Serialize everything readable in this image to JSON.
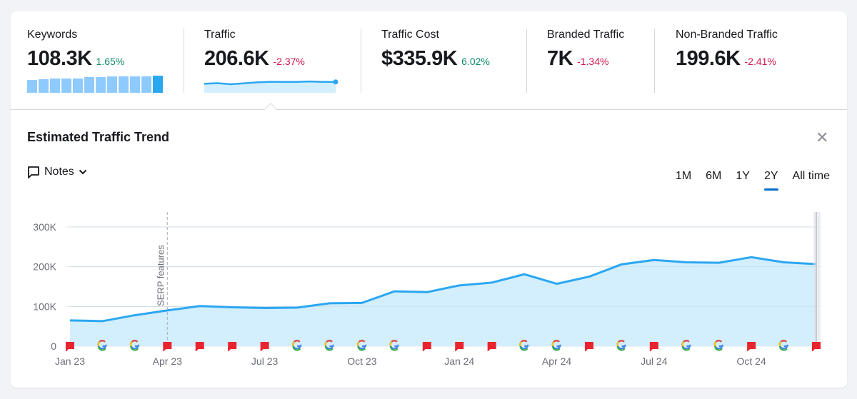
{
  "metrics": [
    {
      "label": "Keywords",
      "value": "108.3K",
      "delta": "1.65%",
      "trend": "positive"
    },
    {
      "label": "Traffic",
      "value": "206.6K",
      "delta": "-2.37%",
      "trend": "negative"
    },
    {
      "label": "Traffic Cost",
      "value": "$335.9K",
      "delta": "6.02%",
      "trend": "positive"
    },
    {
      "label": "Branded Traffic",
      "value": "7K",
      "delta": "-1.34%",
      "trend": "negative"
    },
    {
      "label": "Non-Branded Traffic",
      "value": "199.6K",
      "delta": "-2.41%",
      "trend": "negative"
    }
  ],
  "keywords_sparkbars": [
    0.7,
    0.74,
    0.77,
    0.77,
    0.77,
    0.83,
    0.86,
    0.9,
    0.9,
    0.9,
    0.9,
    0.92
  ],
  "traffic_sparkline": [
    0.62,
    0.68,
    0.57,
    0.66,
    0.76,
    0.81,
    0.8,
    0.8,
    0.85,
    0.8,
    0.8
  ],
  "panel": {
    "title": "Estimated Traffic Trend",
    "close_icon": "close-icon",
    "notes_label": "Notes",
    "notes_icon": "comment-icon",
    "periods": [
      "1M",
      "6M",
      "1Y",
      "2Y",
      "All time"
    ],
    "active_period": "2Y"
  },
  "colors": {
    "line": "#2ba7f1",
    "area": "#d3eefd",
    "flag": "#e8242e",
    "active_tab": "#006dca",
    "positive": "#0e8a6a",
    "negative": "#d1164b"
  },
  "chart_data": {
    "type": "area",
    "title": "Estimated Traffic Trend",
    "xlabel": "",
    "ylabel": "",
    "ylim": [
      0,
      300000
    ],
    "yticks": [
      0,
      100000,
      200000,
      300000
    ],
    "ytick_labels": [
      "0",
      "100K",
      "200K",
      "300K"
    ],
    "grid": true,
    "x": [
      "Jan 23",
      "Feb 23",
      "Mar 23",
      "Apr 23",
      "May 23",
      "Jun 23",
      "Jul 23",
      "Aug 23",
      "Sep 23",
      "Oct 23",
      "Nov 23",
      "Dec 23",
      "Jan 24",
      "Feb 24",
      "Mar 24",
      "Apr 24",
      "May 24",
      "Jun 24",
      "Jul 24",
      "Aug 24",
      "Sep 24",
      "Oct 24",
      "Nov 24",
      "Dec 24"
    ],
    "xtick_labels": [
      "Jan 23",
      "Apr 23",
      "Jul 23",
      "Oct 23",
      "Jan 24",
      "Apr 24",
      "Jul 24",
      "Oct 24"
    ],
    "series": [
      {
        "name": "Traffic",
        "values": [
          65000,
          63000,
          78000,
          90000,
          101000,
          98000,
          96000,
          97000,
          108000,
          109000,
          138000,
          136000,
          153000,
          160000,
          181000,
          157000,
          175000,
          206000,
          217000,
          211000,
          210000,
          224000,
          211000,
          206600
        ]
      }
    ],
    "annotations": [
      {
        "x": "Apr 23",
        "label": "SERP features",
        "style": "dashed-vertical"
      }
    ],
    "markers": [
      "note",
      "google",
      "google",
      "note",
      "note",
      "note",
      "note",
      "google",
      "google",
      "google",
      "google",
      "note",
      "note",
      "note",
      "google",
      "google",
      "note",
      "google",
      "note",
      "google",
      "google",
      "note",
      "google",
      "note"
    ]
  }
}
